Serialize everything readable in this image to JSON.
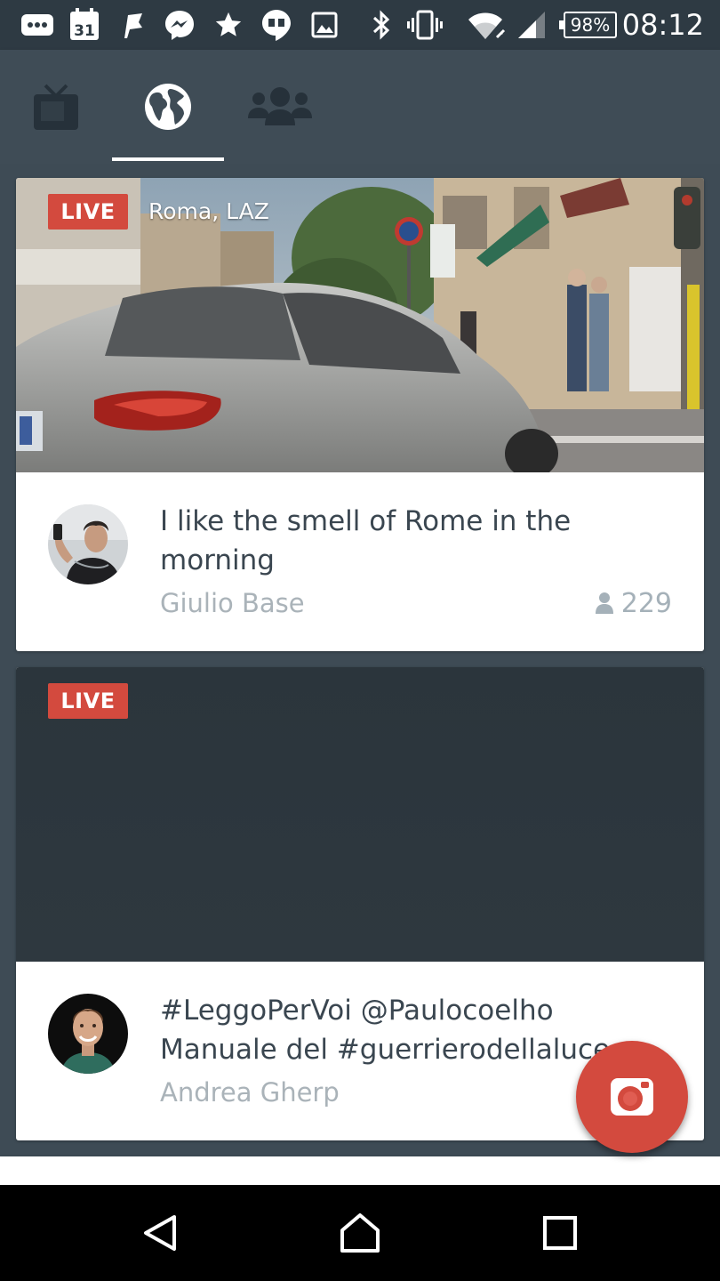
{
  "status_bar": {
    "calendar_day": "31",
    "battery": "98%",
    "time": "08:12",
    "icons": [
      "messages-icon",
      "calendar-icon",
      "flag-icon",
      "messenger-icon",
      "star-icon",
      "hangouts-icon",
      "image-icon",
      "bluetooth-icon",
      "vibrate-icon",
      "wifi-icon",
      "signal-icon",
      "battery-icon"
    ]
  },
  "tabs": [
    {
      "name": "tv",
      "icon": "tv-icon"
    },
    {
      "name": "global",
      "icon": "globe-icon",
      "selected": true
    },
    {
      "name": "people",
      "icon": "people-icon"
    }
  ],
  "feed": {
    "items": [
      {
        "live_label": "LIVE",
        "location": "Roma, LAZ",
        "title": "I like the smell of Rome in the morning",
        "user": "Giulio Base",
        "viewers": "229"
      },
      {
        "live_label": "LIVE",
        "title": "#LeggoPerVoi @Paulocoelho Manuale del #guerrierodellaluce",
        "user": "Andrea Gherp"
      }
    ]
  },
  "colors": {
    "accent": "#d34a3e",
    "background": "#3e4b55",
    "status_bar": "#2e3a43"
  }
}
